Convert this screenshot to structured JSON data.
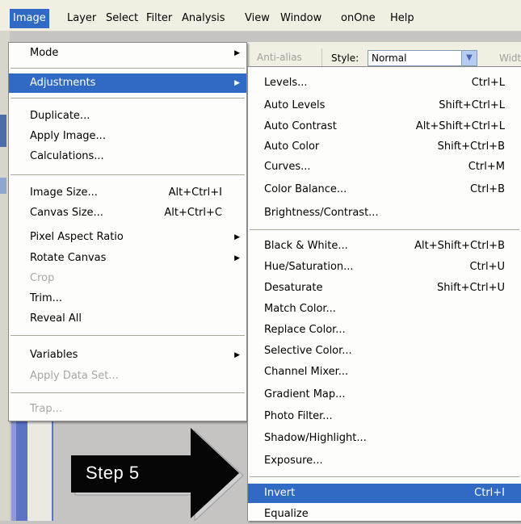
{
  "menubar": {
    "items": [
      "Image",
      "Layer",
      "Select",
      "Filter",
      "Analysis",
      "View",
      "Window",
      "onOne",
      "Help"
    ]
  },
  "options_bar": {
    "anti_alias": "Anti-alias",
    "style_label": "Style:",
    "style_value": "Normal",
    "width_label": "Widt"
  },
  "image_menu": [
    {
      "label": "Mode",
      "submenu": true
    },
    {
      "label": "Adjustments",
      "submenu": true,
      "highlighted": true
    },
    {
      "label": "Duplicate..."
    },
    {
      "label": "Apply Image..."
    },
    {
      "label": "Calculations..."
    },
    {
      "label": "Image Size...",
      "shortcut": "Alt+Ctrl+I"
    },
    {
      "label": "Canvas Size...",
      "shortcut": "Alt+Ctrl+C"
    },
    {
      "label": "Pixel Aspect Ratio",
      "submenu": true
    },
    {
      "label": "Rotate Canvas",
      "submenu": true
    },
    {
      "label": "Crop",
      "disabled": true
    },
    {
      "label": "Trim..."
    },
    {
      "label": "Reveal All"
    },
    {
      "label": "Variables",
      "submenu": true
    },
    {
      "label": "Apply Data Set...",
      "disabled": true
    },
    {
      "label": "Trap...",
      "disabled": true
    }
  ],
  "adjustments_menu": [
    {
      "label": "Levels...",
      "shortcut": "Ctrl+L"
    },
    {
      "label": "Auto Levels",
      "shortcut": "Shift+Ctrl+L"
    },
    {
      "label": "Auto Contrast",
      "shortcut": "Alt+Shift+Ctrl+L"
    },
    {
      "label": "Auto Color",
      "shortcut": "Shift+Ctrl+B"
    },
    {
      "label": "Curves...",
      "shortcut": "Ctrl+M"
    },
    {
      "label": "Color Balance...",
      "shortcut": "Ctrl+B"
    },
    {
      "label": "Brightness/Contrast..."
    },
    {
      "label": "Black & White...",
      "shortcut": "Alt+Shift+Ctrl+B"
    },
    {
      "label": "Hue/Saturation...",
      "shortcut": "Ctrl+U"
    },
    {
      "label": "Desaturate",
      "shortcut": "Shift+Ctrl+U"
    },
    {
      "label": "Match Color..."
    },
    {
      "label": "Replace Color..."
    },
    {
      "label": "Selective Color..."
    },
    {
      "label": "Channel Mixer..."
    },
    {
      "label": "Gradient Map..."
    },
    {
      "label": "Photo Filter..."
    },
    {
      "label": "Shadow/Highlight..."
    },
    {
      "label": "Exposure..."
    },
    {
      "label": "Invert",
      "shortcut": "Ctrl+I",
      "highlighted": true
    },
    {
      "label": "Equalize"
    }
  ],
  "callout": {
    "text": "Step 5"
  }
}
